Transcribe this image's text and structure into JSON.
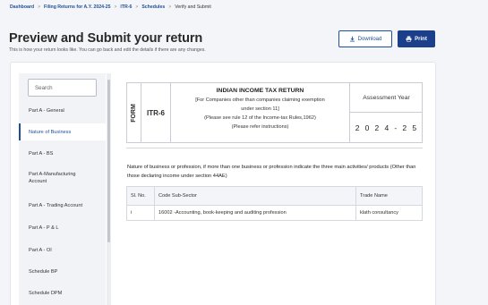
{
  "breadcrumb": {
    "items": [
      "Dashboard",
      "Filing Returns for A.Y. 2024-25",
      "ITR-6",
      "Schedules"
    ],
    "current": "Verify and Submit",
    "separator": ">"
  },
  "page": {
    "title": "Preview and Submit your return",
    "subtitle": "This is how your return looks like. You can go back and edit the details if there are any changes."
  },
  "actions": {
    "download_label": "Download",
    "print_label": "Print"
  },
  "sidebar": {
    "search_placeholder": "Search",
    "items": [
      {
        "label": "Part A - General"
      },
      {
        "label": "Nature of Business"
      },
      {
        "label": "Part A - BS"
      },
      {
        "label": "Part A-Manufacturing Account"
      },
      {
        "label": "Part A - Trading Account"
      },
      {
        "label": "Part A - P & L"
      },
      {
        "label": "Part A - OI"
      },
      {
        "label": "Schedule BP"
      },
      {
        "label": "Schedule DPM"
      }
    ],
    "active_index": 1
  },
  "return_header": {
    "form_label": "FORM",
    "form_name": "ITR-6",
    "title": "INDIAN INCOME TAX RETURN",
    "lines": [
      "[For Companies other than companies claiming exemption",
      "under section 11]",
      "(Please see rule 12 of the Income-tax Rules,1962)",
      "(Please refer instructions)"
    ],
    "assessment_year_label": "Assessment Year",
    "assessment_year_value": "2024-25"
  },
  "nature_section": {
    "description": "Nature of business or profession, if more than one business or profession indicate the three main activities/ products (Other than those declaring income under section 44AE)",
    "columns": [
      "Sl. No.",
      "Code Sub-Sector",
      "Trade Name"
    ],
    "rows": [
      [
        "i",
        "16002 -Accounting, book-keeping and auditing profession",
        "klath consultancy"
      ]
    ]
  },
  "colors": {
    "accent": "#1f4f9c",
    "print_button": "#1c3f8c",
    "background": "#f4f5f8"
  },
  "icons": {
    "download": "download-icon",
    "print": "print-icon"
  }
}
